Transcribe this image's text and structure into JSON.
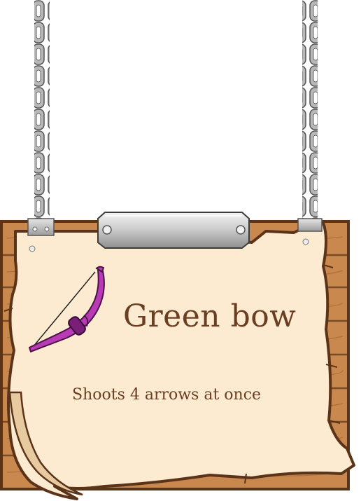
{
  "item": {
    "name": "Green bow",
    "description": "Shoots 4 arrows at once",
    "icon": "bow-icon"
  },
  "colors": {
    "board_wood": "#c8884e",
    "parchment": "#fcebd0",
    "text": "#6a3f21",
    "bow": "#b83ab5"
  }
}
